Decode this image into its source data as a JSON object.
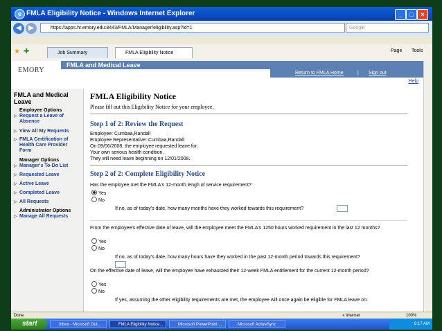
{
  "window": {
    "title": "FMLA Eligibility Notice - Windows Internet Explorer"
  },
  "address": {
    "url": "https://apps.hr.emory.edu:8443/FMLA/Manager/eligibility.asp?id=1",
    "search_placeholder": "Google"
  },
  "tabs": [
    {
      "label": "Job Summary"
    },
    {
      "label": "FMLA Eligibility Notice"
    }
  ],
  "toolbar": {
    "page": "Page",
    "tools": "Tools"
  },
  "banner": {
    "logo": "EMORY",
    "app_title": "FMLA and Medical Leave",
    "return_link": "Return to FMLA Home",
    "sep": "|",
    "signout": "Sign out",
    "help": "Help"
  },
  "sidebar": {
    "title": "FMLA and Medical Leave",
    "employee_head": "Employee Options",
    "request_leave": "Request a Leave of Absence",
    "view_requests": "View All My Requests",
    "certification": "FMLA Certification of Health Care Provider Form",
    "manager_head": "Manager Options",
    "todo": "Manager's To-Do List",
    "requested": "Requested Leave",
    "active": "Active Leave",
    "completed": "Completed Leave",
    "all_requests": "All Requests",
    "admin_head": "Administrator Options",
    "manage_all": "Manage All Requests"
  },
  "main": {
    "title": "FMLA Eligibility Notice",
    "intro": "Please fill out this Eligibility Notice for your employee.",
    "step1": "Step 1 of 2: Review the Request",
    "employee": "Employee: Cumbaa,Randall",
    "rep": "Employee Representative: Cumbaa,Randall",
    "requested_on": "On 09/06/2008, the employee requested leave for:",
    "reason": "Your own serious health condition.",
    "begin": "They will need leave beginning on 12/01/2008.",
    "step2": "Step 2 of 2: Complete Eligibility Notice",
    "q1": "Has the employee met the FMLA's 12-month lengh of service requirement?",
    "yes": "Yes",
    "no": "No",
    "q1_followup": "If no, as of today's date, how many months have they worked towards this requirement?",
    "q2": "From the employee's effective date of leave, will the employee meet the FMLA's 1250 hours worked requirement in the last 12 months?",
    "q2_followup": "If no, as of today's date, how many hours have they worked in the past 12-month period towards this requirement?",
    "q3": "On the effective date of leave, will the employee have exhausted their 12-week FMLA entitlement for the current 12-month period?",
    "q3_followup": "If yes, assuming the other eligibility requirements are met, the employee will once again be eligible for FMLA leave on:",
    "q1_selected": "Yes"
  },
  "status": {
    "left": "Done",
    "zone": "Internet",
    "zoom": "100%"
  },
  "taskbar": {
    "start": "start",
    "items": [
      {
        "label": "Inbox - Microsoft Out..."
      },
      {
        "label": "FMLA Eligibility Notice..."
      },
      {
        "label": "Microsoft PowerPoint ..."
      },
      {
        "label": "Microsoft ActiveSync"
      }
    ],
    "time": "8:17 AM"
  }
}
